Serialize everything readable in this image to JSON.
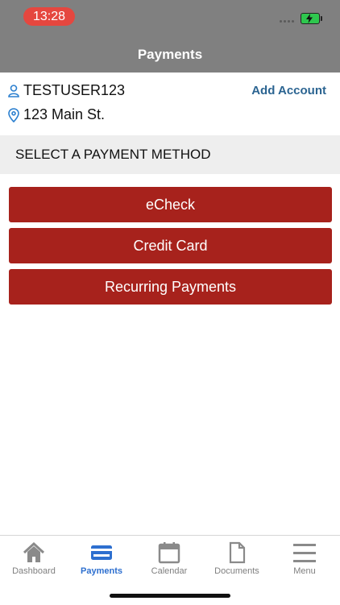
{
  "status_bar": {
    "time": "13:28"
  },
  "header": {
    "title": "Payments"
  },
  "account": {
    "username": "TESTUSER123",
    "address": "123 Main St.",
    "add_account_label": "Add Account"
  },
  "section": {
    "title": "SELECT A PAYMENT METHOD"
  },
  "payment_methods": [
    "eCheck",
    "Credit Card",
    "Recurring Payments"
  ],
  "tabs": [
    {
      "label": "Dashboard",
      "icon": "home-icon"
    },
    {
      "label": "Payments",
      "icon": "credit-card-icon",
      "active": true
    },
    {
      "label": "Calendar",
      "icon": "calendar-icon"
    },
    {
      "label": "Documents",
      "icon": "document-icon"
    },
    {
      "label": "Menu",
      "icon": "menu-icon"
    }
  ],
  "colors": {
    "header": "#808080",
    "accent": "#a7221c",
    "link": "#2b6491",
    "active_tab": "#2d6fcf"
  }
}
